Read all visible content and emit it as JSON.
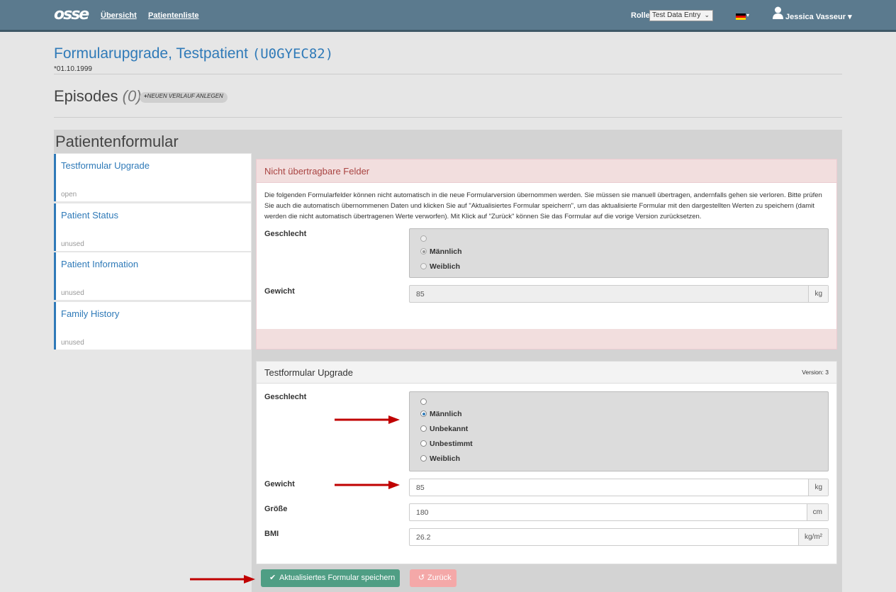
{
  "navbar": {
    "logo": "osse",
    "links": [
      "Übersicht",
      "Patientenliste"
    ],
    "role_label": "Rolle",
    "role_value": "Test Data Entry",
    "user_name": "Jessica Vasseur",
    "user_caret": "▾"
  },
  "patient": {
    "title": "Formularupgrade, Testpatient",
    "id": "(U0GYEC82)",
    "birth": "*01.10.1999"
  },
  "episodes": {
    "label": "Episodes",
    "count": "(0)",
    "new_button": "NEUEN VERLAUF ANLEGEN"
  },
  "patient_form": {
    "title": "Patientenformular",
    "sidebar": [
      {
        "name": "Testformular Upgrade",
        "status": "open"
      },
      {
        "name": "Patient Status",
        "status": "unused"
      },
      {
        "name": "Patient Information",
        "status": "unused"
      },
      {
        "name": "Family History",
        "status": "unused"
      }
    ]
  },
  "warning_panel": {
    "title": "Nicht übertragbare Felder",
    "text": "Die folgenden Formularfelder können nicht automatisch in die neue Formularversion übernommen werden. Sie müssen sie manuell übertragen, andernfalls gehen sie verloren. Bitte prüfen Sie auch die automatisch übernommenen Daten und klicken Sie auf \"Aktualisiertes Formular speichern\", um das aktualisierte Formular mit den dargestellten Werten zu speichern (damit werden die nicht automatisch übertragenen Werte verworfen). Mit Klick auf \"Zurück\" können Sie das Formular auf die vorige Version zurücksetzen.",
    "gender_label": "Geschlecht",
    "gender_options": [
      "",
      "Männlich",
      "Weiblich"
    ],
    "gender_selected": "Männlich",
    "weight_label": "Gewicht",
    "weight_value": "85",
    "weight_unit": "kg"
  },
  "form_panel": {
    "title": "Testformular Upgrade",
    "version": "Version: 3",
    "gender_label": "Geschlecht",
    "gender_options": [
      "",
      "Männlich",
      "Unbekannt",
      "Unbestimmt",
      "Weiblich"
    ],
    "gender_selected": "Männlich",
    "weight_label": "Gewicht",
    "weight_value": "85",
    "weight_unit": "kg",
    "height_label": "Größe",
    "height_value": "180",
    "height_unit": "cm",
    "bmi_label": "BMI",
    "bmi_value": "26.2",
    "bmi_unit": "kg/m²"
  },
  "actions": {
    "save": "Aktualisiertes Formular speichern",
    "back": "Zurück"
  },
  "colors": {
    "navbar": "#5b7a8e",
    "link": "#2f7ab8",
    "warning_bg": "#f2dede",
    "arrow": "#c00000",
    "save": "#4f9e84",
    "back": "#f4a8a8"
  },
  "icons": [
    "user-icon",
    "flag-de-icon",
    "plus-icon",
    "check-icon",
    "undo-icon",
    "arrow-right-icon"
  ]
}
